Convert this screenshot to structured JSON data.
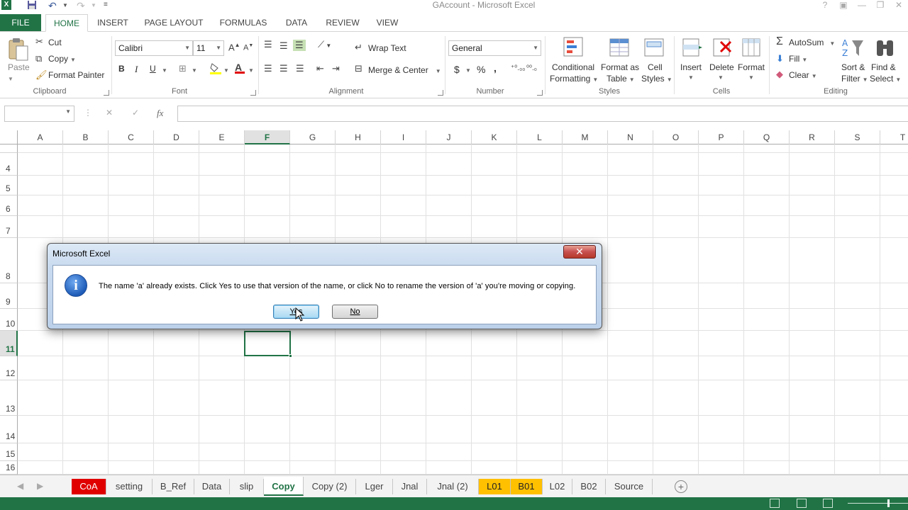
{
  "window": {
    "title": "GAccount - Microsoft Excel",
    "help_glyph": "?",
    "minimize_glyph": "—",
    "restore_glyph": "❐",
    "close_glyph": "✕"
  },
  "ribbon_tabs": [
    "FILE",
    "HOME",
    "INSERT",
    "PAGE LAYOUT",
    "FORMULAS",
    "DATA",
    "REVIEW",
    "VIEW"
  ],
  "active_tab": "HOME",
  "clipboard": {
    "paste": "Paste",
    "cut": "Cut",
    "copy": "Copy",
    "format_painter": "Format Painter",
    "label": "Clipboard"
  },
  "font": {
    "name": "Calibri",
    "size": "11",
    "bold": "B",
    "italic": "I",
    "underline": "U",
    "label": "Font"
  },
  "alignment": {
    "wrap_text": "Wrap Text",
    "merge_center": "Merge & Center",
    "label": "Alignment"
  },
  "number": {
    "format": "General",
    "currency": "$",
    "percent": "%",
    "comma": ",",
    "label": "Number"
  },
  "styles": {
    "conditional_1": "Conditional",
    "conditional_2": "Formatting",
    "format_as_1": "Format as",
    "format_as_2": "Table",
    "cell_styles_1": "Cell",
    "cell_styles_2": "Styles",
    "label": "Styles"
  },
  "cells": {
    "insert": "Insert",
    "delete": "Delete",
    "format": "Format",
    "label": "Cells"
  },
  "editing": {
    "autosum": "AutoSum",
    "fill": "Fill",
    "clear": "Clear",
    "sort_1": "Sort &",
    "sort_2": "Filter",
    "find_1": "Find &",
    "find_2": "Select",
    "label": "Editing"
  },
  "formula_bar": {
    "name_box": "",
    "cancel": "✕",
    "enter": "✓",
    "fx": "fx",
    "value": ""
  },
  "columns": [
    "A",
    "B",
    "C",
    "D",
    "E",
    "F",
    "G",
    "H",
    "I",
    "J",
    "K",
    "L",
    "M",
    "N",
    "O",
    "P",
    "Q",
    "R",
    "S",
    "T"
  ],
  "selected_column": "F",
  "rows": [
    "4",
    "5",
    "6",
    "7",
    "8",
    "9",
    "10",
    "11",
    "12",
    "13",
    "14",
    "15",
    "16"
  ],
  "selected_row": "11",
  "sheets": [
    {
      "name": "CoA",
      "style": "red"
    },
    {
      "name": "setting",
      "style": ""
    },
    {
      "name": "B_Ref",
      "style": ""
    },
    {
      "name": "Data",
      "style": ""
    },
    {
      "name": "slip",
      "style": ""
    },
    {
      "name": "Copy",
      "style": "active"
    },
    {
      "name": "Copy (2)",
      "style": ""
    },
    {
      "name": "Lger",
      "style": ""
    },
    {
      "name": "Jnal",
      "style": ""
    },
    {
      "name": "Jnal (2)",
      "style": ""
    },
    {
      "name": "L01",
      "style": "gold"
    },
    {
      "name": "B01",
      "style": "gold"
    },
    {
      "name": "L02",
      "style": ""
    },
    {
      "name": "B02",
      "style": ""
    },
    {
      "name": "Source",
      "style": ""
    }
  ],
  "dialog": {
    "title": "Microsoft Excel",
    "message": "The name 'a' already exists. Click Yes to use that version of the name, or click No to rename the version of 'a' you're moving or copying.",
    "yes": "Yes",
    "no": "No",
    "close": "✕"
  },
  "colors": {
    "excel_green": "#217346",
    "red_tab": "#e00000",
    "gold_tab": "#ffc000"
  }
}
